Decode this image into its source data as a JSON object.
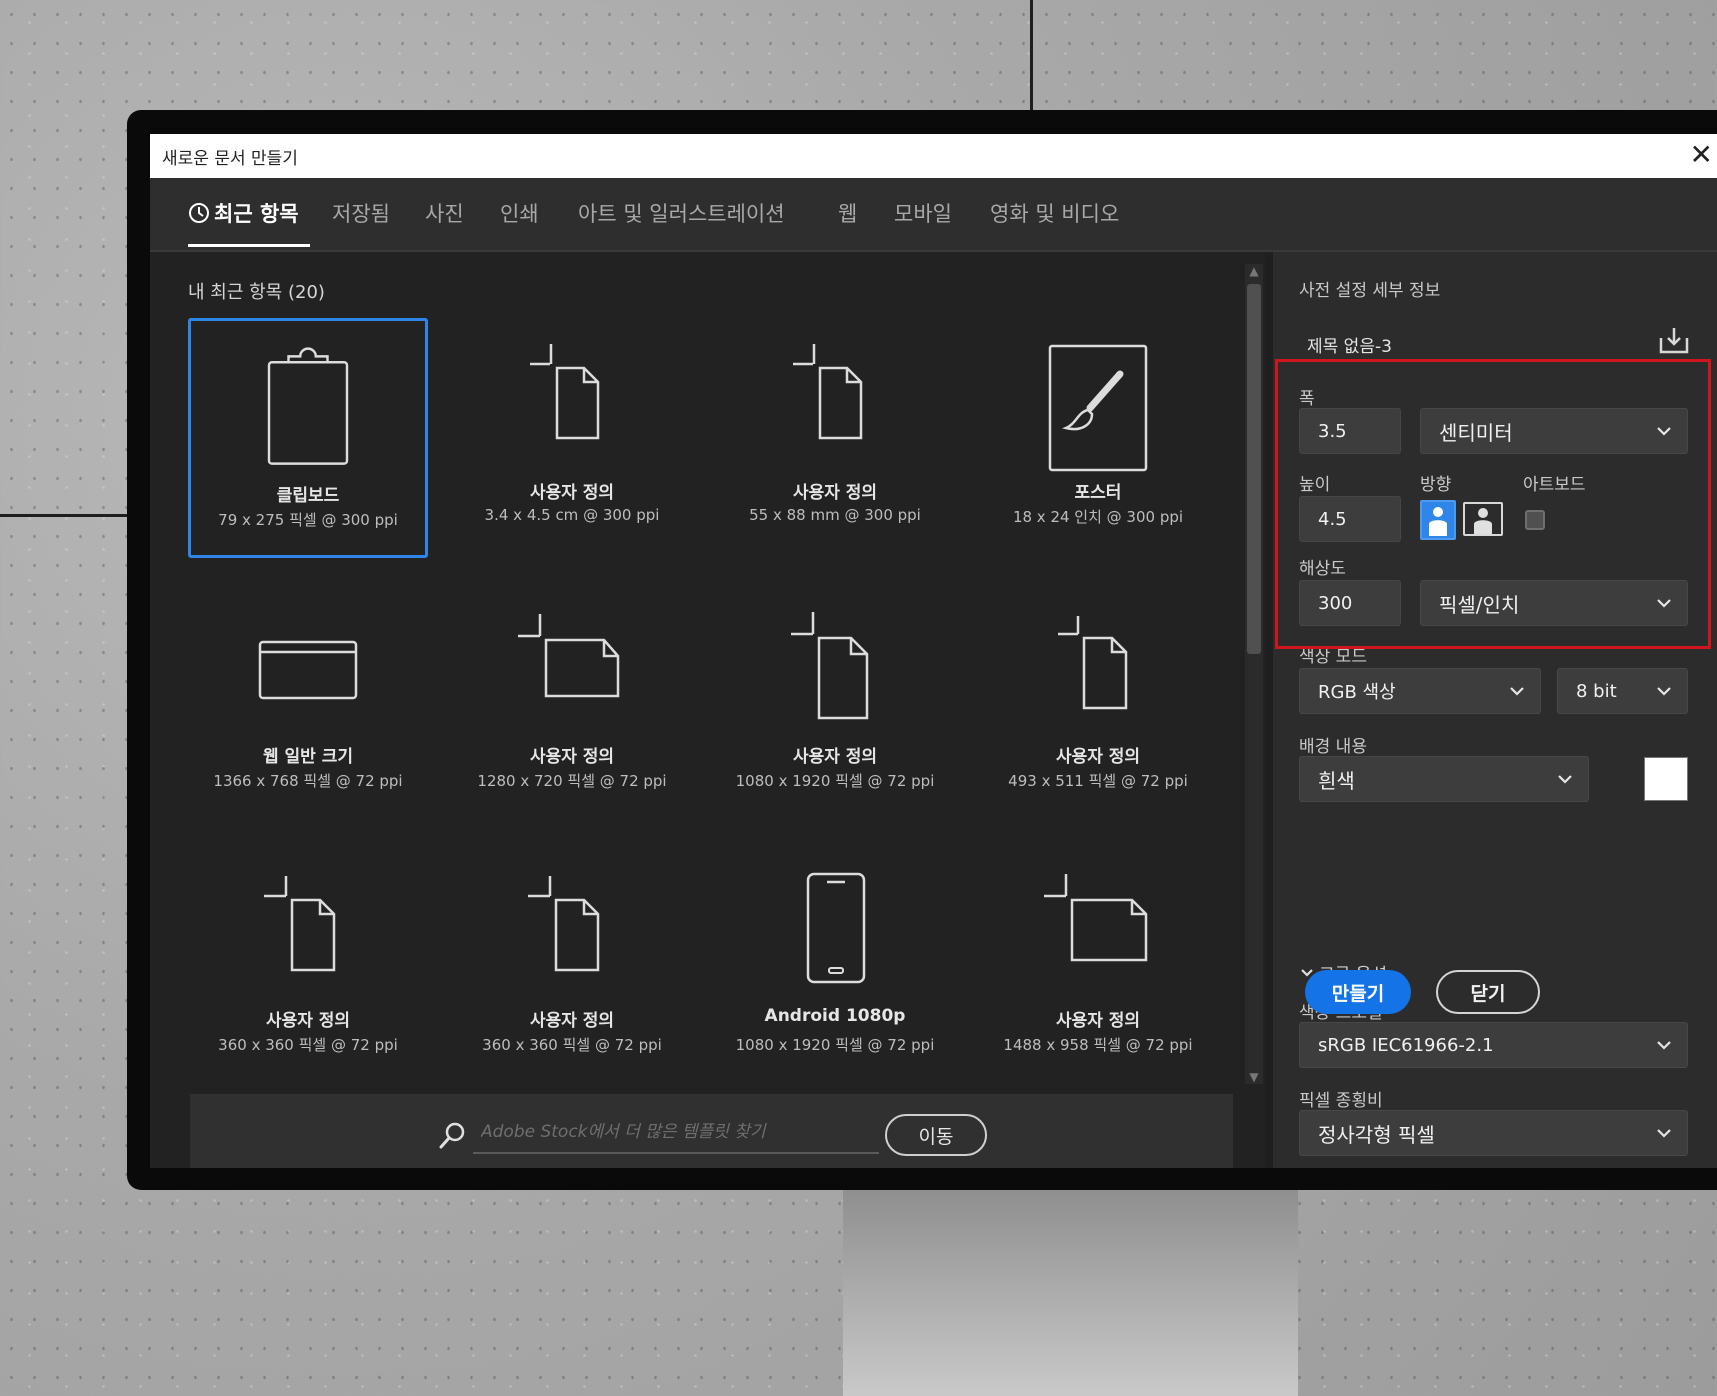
{
  "window": {
    "title": "새로운 문서 만들기",
    "close_glyph": "✕"
  },
  "tabs": [
    {
      "label": "최근 항목",
      "active": true
    },
    {
      "label": "저장됨"
    },
    {
      "label": "사진"
    },
    {
      "label": "인쇄"
    },
    {
      "label": "아트 및 일러스트레이션"
    },
    {
      "label": "웹"
    },
    {
      "label": "모바일"
    },
    {
      "label": "영화 및 비디오"
    }
  ],
  "recent": {
    "heading": "내 최근 항목  (20)",
    "items": [
      {
        "name": "클립보드",
        "meta": "79 x 275 픽셀 @ 300 ppi",
        "icon": "clipboard-icon",
        "selected": true
      },
      {
        "name": "사용자 정의",
        "meta": "3.4 x 4.5 cm @ 300 ppi",
        "icon": "custom-portrait-icon"
      },
      {
        "name": "사용자 정의",
        "meta": "55 x 88 mm @ 300 ppi",
        "icon": "custom-portrait-icon"
      },
      {
        "name": "포스터",
        "meta": "18 x 24 인치 @ 300 ppi",
        "icon": "poster-brush-icon"
      },
      {
        "name": "웹 일반 크기",
        "meta": "1366 x 768 픽셀 @ 72 ppi",
        "icon": "web-browser-icon"
      },
      {
        "name": "사용자 정의",
        "meta": "1280 x 720 픽셀 @ 72 ppi",
        "icon": "custom-landscape-icon"
      },
      {
        "name": "사용자 정의",
        "meta": "1080 x 1920 픽셀 @ 72 ppi",
        "icon": "custom-tall-icon"
      },
      {
        "name": "사용자 정의",
        "meta": "493 x 511 픽셀 @ 72 ppi",
        "icon": "custom-portrait-icon"
      },
      {
        "name": "사용자 정의",
        "meta": "360 x 360 픽셀 @ 72 ppi",
        "icon": "custom-portrait-icon"
      },
      {
        "name": "사용자 정의",
        "meta": "360 x 360 픽셀 @ 72 ppi",
        "icon": "custom-portrait-icon"
      },
      {
        "name": "Android 1080p",
        "meta": "1080 x 1920 픽셀 @ 72 ppi",
        "icon": "phone-icon"
      },
      {
        "name": "사용자 정의",
        "meta": "1488 x 958 픽셀 @ 72 ppi",
        "icon": "custom-landscape-icon"
      }
    ]
  },
  "stock": {
    "placeholder": "Adobe Stock에서 더 많은 템플릿 찾기",
    "go_label": "이동"
  },
  "preset": {
    "heading": "사전 설정 세부 정보",
    "doc_name": "제목 없음-3",
    "width_label": "폭",
    "width_value": "3.5",
    "width_unit": "센티미터",
    "height_label": "높이",
    "height_value": "4.5",
    "orientation_label": "방향",
    "orientation": "portrait",
    "artboard_label": "아트보드",
    "artboard_checked": false,
    "resolution_label": "해상도",
    "resolution_value": "300",
    "resolution_unit": "픽셀/인치",
    "color_mode_label": "색상 모드",
    "color_mode": "RGB 색상",
    "bit_depth": "8 bit",
    "background_label": "배경 내용",
    "background": "흰색",
    "background_swatch": "#ffffff",
    "advanced_label": "고급 옵션",
    "profile_label": "색상 프로필",
    "profile": "sRGB IEC61966-2.1",
    "pixel_aspect_label": "픽셀 종횡비",
    "pixel_aspect": "정사각형 픽셀"
  },
  "actions": {
    "create_label": "만들기",
    "close_label": "닫기"
  },
  "colors": {
    "accent": "#1473e6",
    "selection": "#2f86e8",
    "highlight_box": "#d0161a"
  }
}
